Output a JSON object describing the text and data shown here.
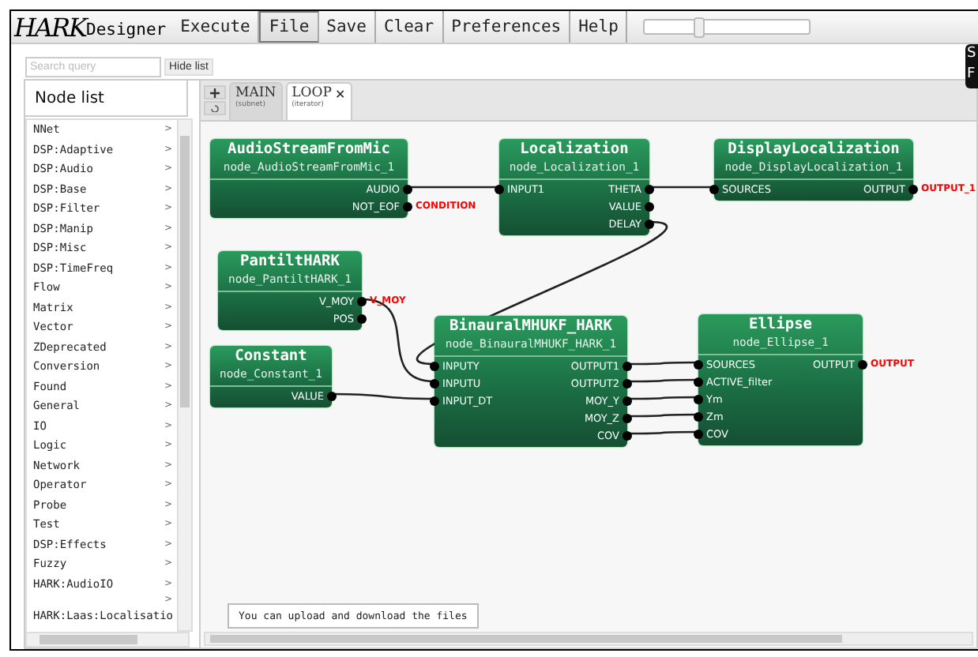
{
  "app": {
    "logo": "HARK",
    "name": "Designer"
  },
  "menu": [
    {
      "label": "Execute",
      "selected": false
    },
    {
      "label": "File",
      "selected": true
    },
    {
      "label": "Save",
      "selected": false
    },
    {
      "label": "Clear",
      "selected": false
    },
    {
      "label": "Preferences",
      "selected": false
    },
    {
      "label": "Help",
      "selected": false
    }
  ],
  "zoom_slider": {
    "level": 0.32
  },
  "side_badge": [
    "S",
    "F"
  ],
  "search": {
    "placeholder": "Search query",
    "button": "Hide list"
  },
  "node_list": {
    "title": "Node list",
    "items": [
      "NNet",
      "DSP:Adaptive",
      "DSP:Audio",
      "DSP:Base",
      "DSP:Filter",
      "DSP:Manip",
      "DSP:Misc",
      "DSP:TimeFreq",
      "Flow",
      "Matrix",
      "Vector",
      "ZDeprecated",
      "Conversion",
      "Found",
      "General",
      "IO",
      "Logic",
      "Network",
      "Operator",
      "Probe",
      "Test",
      "DSP:Effects",
      "Fuzzy",
      "HARK:AudioIO",
      "HARK:Laas:Localisatio"
    ],
    "arrow": ">"
  },
  "tabs": [
    {
      "label": "MAIN",
      "sub": "(subnet)",
      "selected": false
    },
    {
      "label": "LOOP",
      "sub": "(iterator)",
      "selected": true,
      "close": "×"
    }
  ],
  "nodes": [
    {
      "title": "AudioStreamFromMic",
      "id": "node_AudioStreamFromMic_1",
      "outputs": [
        {
          "name": "AUDIO"
        },
        {
          "name": "NOT_EOF",
          "label": "CONDITION"
        }
      ]
    },
    {
      "title": "Localization",
      "id": "node_Localization_1",
      "inputs": [
        "INPUT1"
      ],
      "outputs": [
        {
          "name": "THETA"
        },
        {
          "name": "VALUE"
        },
        {
          "name": "DELAY"
        }
      ]
    },
    {
      "title": "DisplayLocalization",
      "id": "node_DisplayLocalization_1",
      "inputs": [
        "SOURCES"
      ],
      "outputs": [
        {
          "name": "OUTPUT",
          "label": "OUTPUT_1"
        }
      ]
    },
    {
      "title": "PantiltHARK",
      "id": "node_PantiltHARK_1",
      "outputs": [
        {
          "name": "V_MOY",
          "label": "V_MOY"
        },
        {
          "name": "POS"
        }
      ]
    },
    {
      "title": "Constant",
      "id": "node_Constant_1",
      "outputs": [
        {
          "name": "VALUE"
        }
      ]
    },
    {
      "title": "BinauralMHUKF_HARK",
      "id": "node_BinauralMHUKF_HARK_1",
      "inputs": [
        "INPUTY",
        "INPUTU",
        "INPUT_DT"
      ],
      "outputs": [
        {
          "name": "OUTPUT1"
        },
        {
          "name": "OUTPUT2"
        },
        {
          "name": "MOY_Y"
        },
        {
          "name": "MOY_Z"
        },
        {
          "name": "COV"
        }
      ]
    },
    {
      "title": "Ellipse",
      "id": "node_Ellipse_1",
      "inputs": [
        "SOURCES",
        "ACTIVE_filter",
        "Ym",
        "Zm",
        "COV"
      ],
      "outputs": [
        {
          "name": "OUTPUT",
          "label": "OUTPUT"
        }
      ]
    }
  ],
  "tip": "You can upload and download the files"
}
